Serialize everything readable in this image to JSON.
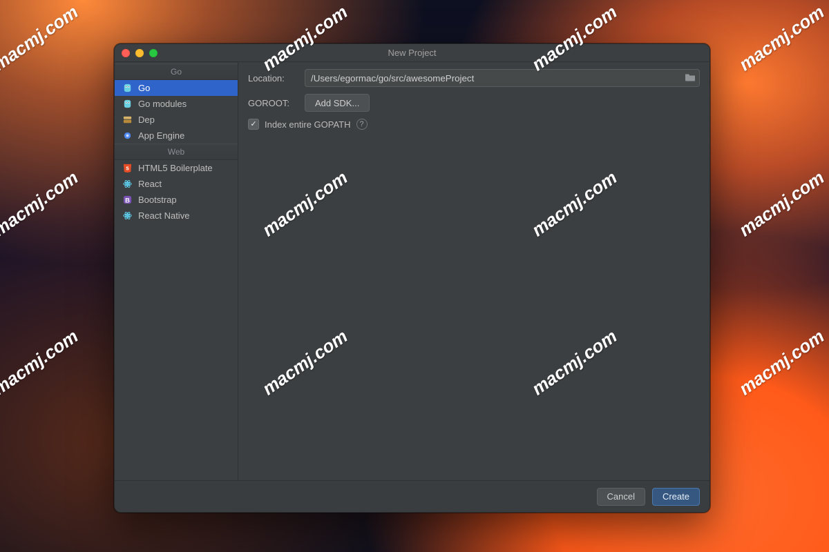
{
  "window": {
    "title": "New Project"
  },
  "sidebar": {
    "sections": [
      {
        "header": "Go",
        "items": [
          {
            "label": "Go",
            "icon": "gopher-icon",
            "selected": true
          },
          {
            "label": "Go modules",
            "icon": "gopher-icon",
            "selected": false
          },
          {
            "label": "Dep",
            "icon": "dep-icon",
            "selected": false
          },
          {
            "label": "App Engine",
            "icon": "appengine-icon",
            "selected": false
          }
        ]
      },
      {
        "header": "Web",
        "items": [
          {
            "label": "HTML5 Boilerplate",
            "icon": "html5-icon",
            "selected": false
          },
          {
            "label": "React",
            "icon": "react-icon",
            "selected": false
          },
          {
            "label": "Bootstrap",
            "icon": "bootstrap-icon",
            "selected": false
          },
          {
            "label": "React Native",
            "icon": "react-icon",
            "selected": false
          }
        ]
      }
    ]
  },
  "form": {
    "location_label": "Location:",
    "location_value": "/Users/egormac/go/src/awesomeProject",
    "goroot_label": "GOROOT:",
    "add_sdk_label": "Add SDK...",
    "index_checkbox_label": "Index entire GOPATH",
    "index_checked": true
  },
  "footer": {
    "cancel_label": "Cancel",
    "create_label": "Create"
  },
  "watermark_text": "macmj.com",
  "colors": {
    "selection": "#2f65ca",
    "dialog_bg": "#3c3f41",
    "primary_btn": "#365880"
  }
}
